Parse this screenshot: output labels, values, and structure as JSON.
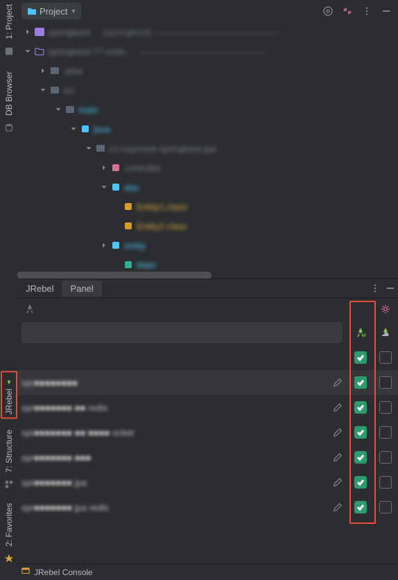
{
  "left_gutter": {
    "project": "1: Project",
    "db": "DB Browser",
    "jrebel": "JRebel",
    "structure": "7: Structure",
    "favorites": "2: Favorites"
  },
  "project_header": {
    "title": "Project",
    "chevron": "▾"
  },
  "tree": {
    "r0_name": "springboot",
    "r0_aux": "[springboot] ——————————————",
    "r1_name": "springboot-??-redis",
    "r1_aux": "——————————————",
    "r2": ".idea",
    "r3": "src",
    "r4": "main",
    "r5": "java",
    "r6": "cn.ruiyeclub.springboot.jpa",
    "r7": "controller",
    "r8": "dao",
    "r9": "Entity1.class",
    "r10": "Entity2.class",
    "r11": "entity",
    "r12": "Main"
  },
  "jrebel": {
    "tab1": "JRebel",
    "tab2": "Panel"
  },
  "table": {
    "rows": [
      {
        "name": "spr■■■■■■■■"
      },
      {
        "name": "spr■■■■■■■ ■■ redis"
      },
      {
        "name": "spr■■■■■■■ ■■ ■■■■ ocket"
      },
      {
        "name": "spr■■■■■■■ ■■■"
      },
      {
        "name": "spr■■■■■■■ jpa"
      },
      {
        "name": "spr■■■■■■■ jpa redis"
      }
    ]
  },
  "bottom": {
    "label": "JRebel Console"
  }
}
